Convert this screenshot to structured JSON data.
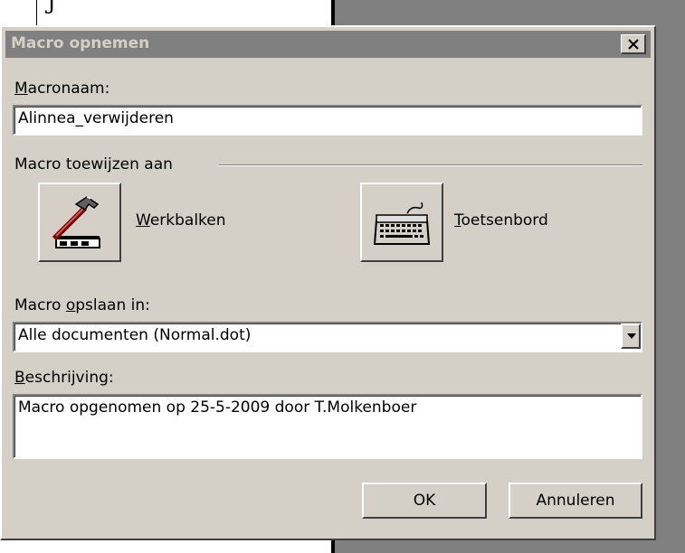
{
  "background": {
    "doc_fragment": "J"
  },
  "dialog": {
    "title": "Macro opnemen",
    "close_glyph": "×",
    "macro_name": {
      "label_mnemonic": "M",
      "label_rest": "acronaam:",
      "value": "Alinnea_verwijderen"
    },
    "assign": {
      "group_label": "Macro toewijzen aan",
      "toolbars_mnemonic": "W",
      "toolbars_rest": "erkbalken",
      "toolbars_icon": "hammer-toolbar-icon",
      "keyboard_mnemonic": "T",
      "keyboard_rest": "oetsenbord",
      "keyboard_icon": "keyboard-icon"
    },
    "store_in": {
      "label_pre": "Macro ",
      "label_mnemonic": "o",
      "label_rest": "pslaan in:",
      "selected": "Alle documenten (Normal.dot)"
    },
    "description": {
      "label_mnemonic": "B",
      "label_rest": "eschrijving:",
      "value": "Macro opgenomen op 25-5-2009 door T.Molkenboer"
    },
    "buttons": {
      "ok": "OK",
      "cancel": "Annuleren"
    }
  }
}
